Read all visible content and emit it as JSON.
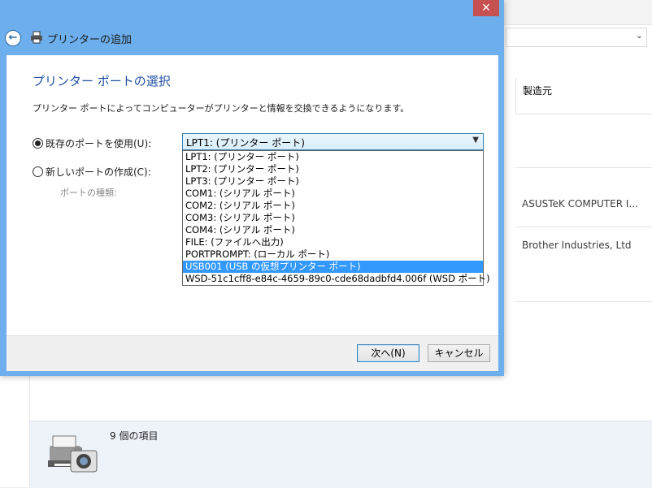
{
  "background_window": {
    "column_header": "製造元",
    "rows": [
      "ASUSTeK COMPUTER I...",
      "Brother Industries, Ltd"
    ],
    "item_count": "9 個の項目"
  },
  "dialog": {
    "close_label": "✕",
    "back_icon": "back-arrow-icon",
    "title": "プリンターの追加",
    "heading": "プリンター ポートの選択",
    "description": "プリンター ポートによってコンピューターがプリンターと情報を交換できるようになります。",
    "existing_port_label": "既存のポートを使用(U):",
    "new_port_label": "新しいポートの作成(C):",
    "port_type_label": "ポートの種類:",
    "existing_port_selected": true,
    "port_select": {
      "value": "LPT1: (プリンター ポート)",
      "options": [
        "LPT1: (プリンター ポート)",
        "LPT2: (プリンター ポート)",
        "LPT3: (プリンター ポート)",
        "COM1: (シリアル ポート)",
        "COM2: (シリアル ポート)",
        "COM3: (シリアル ポート)",
        "COM4: (シリアル ポート)",
        "FILE: (ファイルへ出力)",
        "PORTPROMPT: (ローカル ポート)",
        "USB001 (USB の仮想プリンター ポート)",
        "WSD-51c1cff8-e84c-4659-89c0-cde68dadbfd4.006f (WSD ポート)"
      ],
      "highlighted_index": 9
    },
    "next_button": "次へ(N)",
    "cancel_button": "キャンセル"
  },
  "colors": {
    "dialog_frame": "#6daeed",
    "heading": "#1e4fa1",
    "close_button": "#c75050",
    "highlight": "#3399ff"
  }
}
